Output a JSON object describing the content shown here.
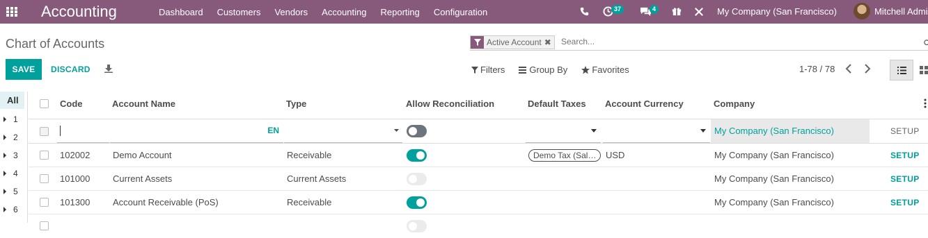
{
  "navbar": {
    "brand": "Accounting",
    "menu": [
      "Dashboard",
      "Customers",
      "Vendors",
      "Accounting",
      "Reporting",
      "Configuration"
    ],
    "activity_count": "37",
    "messages_count": "4",
    "company": "My Company (San Francisco)",
    "user": "Mitchell Admin"
  },
  "control": {
    "title": "Chart of Accounts",
    "facet": "Active Account",
    "search_placeholder": "Search...",
    "save": "SAVE",
    "discard": "DISCARD",
    "filters": "Filters",
    "group_by": "Group By",
    "favorites": "Favorites",
    "pager": "1-78 / 78"
  },
  "side": {
    "all": "All",
    "groups": [
      "1",
      "2",
      "3",
      "4",
      "5",
      "6"
    ]
  },
  "table": {
    "columns": {
      "code": "Code",
      "name": "Account Name",
      "type": "Type",
      "reconcile": "Allow Reconciliation",
      "taxes": "Default Taxes",
      "currency": "Account Currency",
      "company": "Company"
    },
    "edit_row": {
      "lang": "EN",
      "company": "My Company (San Francisco)",
      "setup": "SETUP"
    },
    "rows": [
      {
        "code": "102002",
        "name": "Demo Account",
        "type": "Receivable",
        "reconcile": true,
        "tax": "Demo Tax (Sal…",
        "currency": "USD",
        "company": "My Company (San Francisco)",
        "setup": "SETUP"
      },
      {
        "code": "101000",
        "name": "Current Assets",
        "type": "Current Assets",
        "reconcile": false,
        "tax": "",
        "currency": "",
        "company": "My Company (San Francisco)",
        "setup": "SETUP"
      },
      {
        "code": "101300",
        "name": "Account Receivable (PoS)",
        "type": "Receivable",
        "reconcile": true,
        "tax": "",
        "currency": "",
        "company": "My Company (San Francisco)",
        "setup": "SETUP"
      }
    ]
  },
  "colors": {
    "brand": "#875a7b",
    "accent": "#00a09d"
  }
}
